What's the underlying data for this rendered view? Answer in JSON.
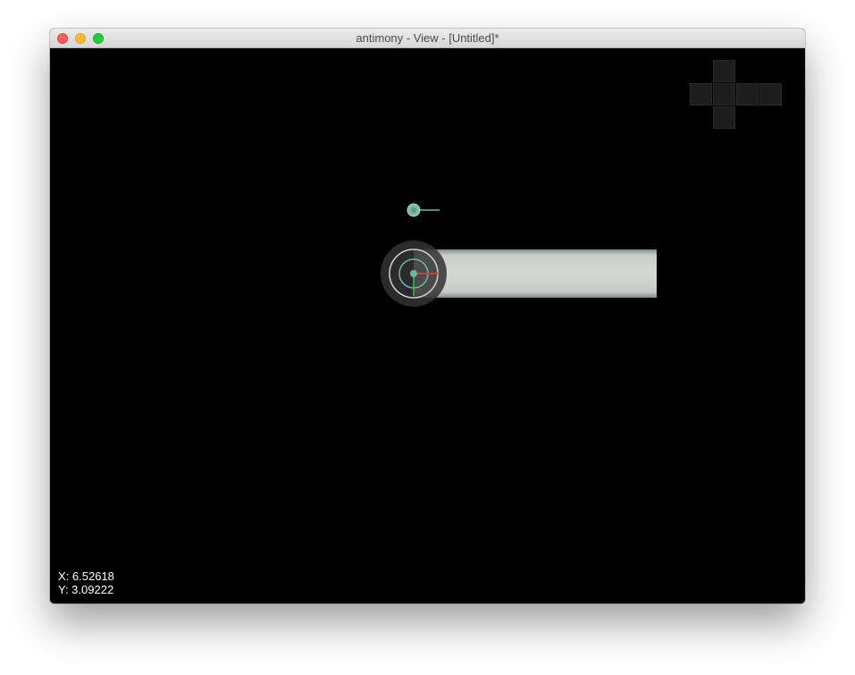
{
  "window": {
    "title": "antimony - View - [Untitled]*",
    "controls": [
      "close",
      "minimize",
      "zoom"
    ]
  },
  "viewport": {
    "background": "#000000",
    "coordinates": {
      "x_label": "X: 6.52618",
      "y_label": "Y: 3.09222"
    }
  },
  "colors": {
    "close": "#fc5f57",
    "minimize": "#fdbc2e",
    "zoom": "#28c840",
    "handle": "#6fb5a6",
    "x_axis": "#d43c3c",
    "y_axis": "#3fbf4a",
    "shape_fill": "#cfd3cd"
  },
  "icons": {
    "view_cube": "view-cube-icon",
    "point_handle": "point-handle-icon",
    "rotation_gizmo": "rotation-gizmo-icon"
  }
}
